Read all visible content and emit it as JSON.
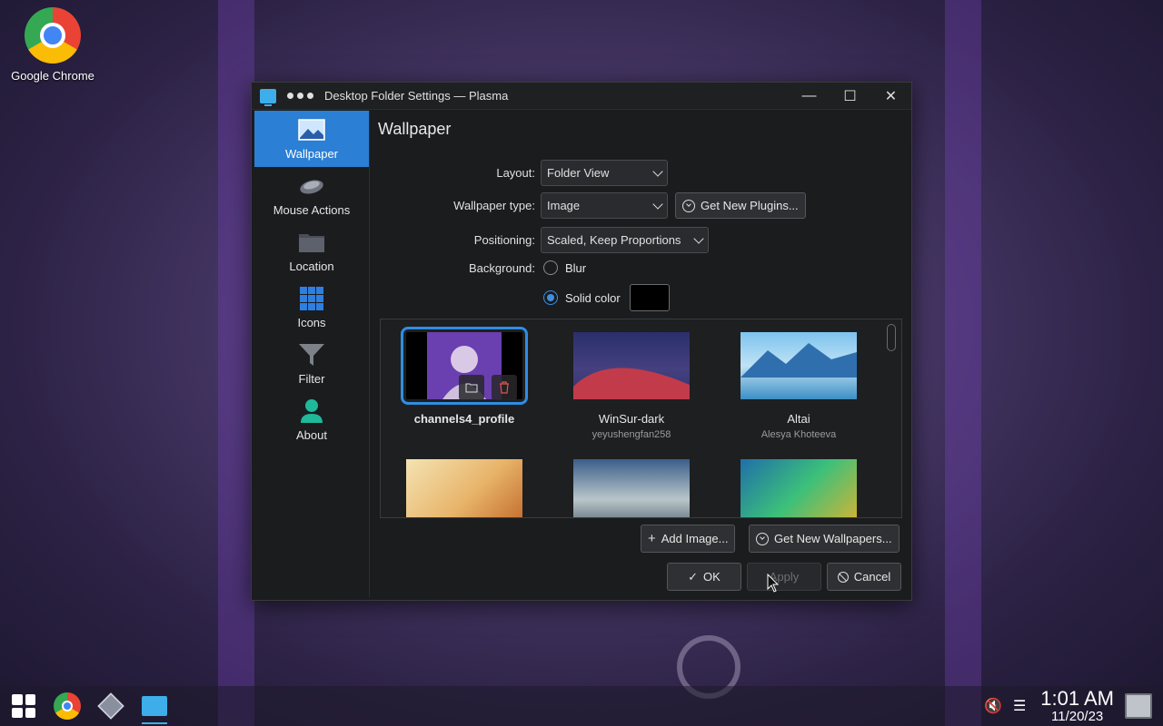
{
  "desktop": {
    "icons": [
      {
        "label": "Google Chrome",
        "icon": "chrome-icon"
      }
    ]
  },
  "window": {
    "title": "Desktop Folder Settings — Plasma",
    "controls": {
      "minimize": "—",
      "maximize": "☐",
      "close": "✕"
    }
  },
  "sidebar": {
    "items": [
      {
        "label": "Wallpaper",
        "icon": "wallpaper-icon",
        "active": true
      },
      {
        "label": "Mouse Actions",
        "icon": "mouse-icon"
      },
      {
        "label": "Location",
        "icon": "folder-icon"
      },
      {
        "label": "Icons",
        "icon": "icons-grid-icon"
      },
      {
        "label": "Filter",
        "icon": "filter-icon"
      },
      {
        "label": "About",
        "icon": "person-icon"
      }
    ]
  },
  "page": {
    "title": "Wallpaper",
    "layout": {
      "label": "Layout:",
      "value": "Folder View"
    },
    "wallpaper_type": {
      "label": "Wallpaper type:",
      "value": "Image",
      "get_plugins": "Get New Plugins..."
    },
    "positioning": {
      "label": "Positioning:",
      "value": "Scaled, Keep Proportions"
    },
    "background": {
      "label": "Background:",
      "options": [
        {
          "label": "Blur",
          "checked": false
        },
        {
          "label": "Solid color",
          "checked": true
        }
      ],
      "color": "#000000"
    },
    "wallpapers": [
      {
        "name": "channels4_profile",
        "author": "",
        "selected": true
      },
      {
        "name": "WinSur-dark",
        "author": "yeyushengfan258"
      },
      {
        "name": "Altai",
        "author": "Alesya Khoteeva"
      },
      {
        "name": "",
        "author": ""
      },
      {
        "name": "",
        "author": ""
      },
      {
        "name": "",
        "author": ""
      }
    ],
    "add_image": "Add Image...",
    "get_wallpapers": "Get New Wallpapers...",
    "ok": "OK",
    "apply": "Apply",
    "cancel": "Cancel"
  },
  "taskbar": {
    "apps": [
      "start-menu-icon",
      "chrome-icon",
      "virtualbox-icon",
      "settings-monitor-icon"
    ],
    "time": "1:01 AM",
    "date": "11/20/23"
  },
  "colors": {
    "accent": "#2f8de4",
    "window_bg": "#1b1c1e",
    "sidebar_active": "#2b7fd4"
  }
}
